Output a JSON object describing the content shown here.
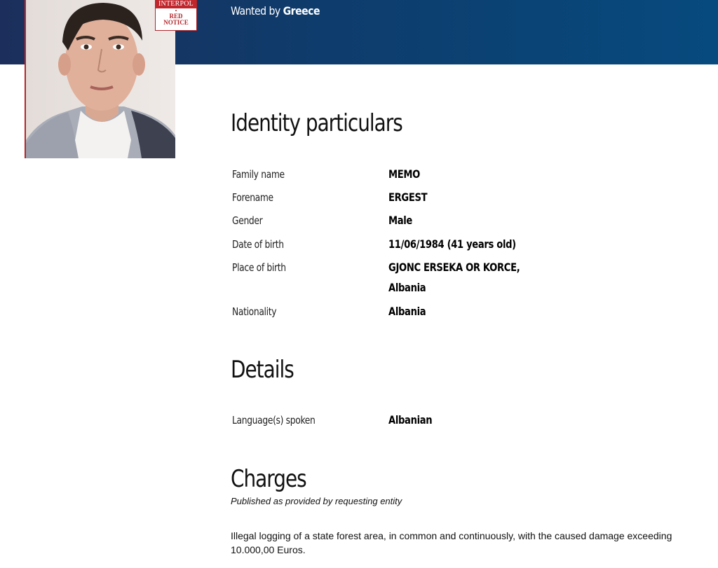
{
  "header": {
    "wanted_prefix": "Wanted by",
    "wanted_country": "Greece"
  },
  "badge": {
    "org": "INTERPOL",
    "notice_line1": "RED",
    "notice_line2": "NOTICE"
  },
  "identity": {
    "title": "Identity particulars",
    "fields": [
      {
        "label": "Family name",
        "value": "MEMO"
      },
      {
        "label": "Forename",
        "value": "ERGEST"
      },
      {
        "label": "Gender",
        "value": "Male"
      },
      {
        "label": "Date of birth",
        "value": "11/06/1984 (41 years old)"
      },
      {
        "label": "Place of birth",
        "value_line1": "GJONC ERSEKA OR KORCE,",
        "value_line2": "Albania"
      },
      {
        "label": "Nationality",
        "value": "Albania"
      }
    ]
  },
  "details": {
    "title": "Details",
    "fields": [
      {
        "label": "Language(s) spoken",
        "value": "Albanian"
      }
    ]
  },
  "charges": {
    "title": "Charges",
    "note": "Published as provided by requesting entity",
    "text": "Illegal logging of a state forest area, in common and continuously, with the caused damage exceeding 10.000,00 Euros."
  },
  "colors": {
    "header_dark": "#1c2f5c",
    "header_light": "#074a7e",
    "accent_red": "#b3262b"
  }
}
